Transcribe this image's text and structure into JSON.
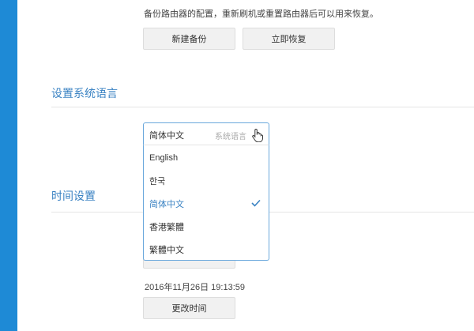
{
  "backup": {
    "description": "备份路由器的配置，重新刷机或重置路由器后可以用来恢复。",
    "new_backup_label": "新建备份",
    "restore_label": "立即恢复"
  },
  "language": {
    "section_title": "设置系统语言",
    "selected_value": "简体中文",
    "selected_hint": "系统语言",
    "options": [
      {
        "label": "English",
        "selected": false
      },
      {
        "label": "한국",
        "selected": false
      },
      {
        "label": "简体中文",
        "selected": true
      },
      {
        "label": "香港繁體",
        "selected": false
      },
      {
        "label": "繁體中文",
        "selected": false
      }
    ]
  },
  "time": {
    "section_title": "时间设置",
    "current_datetime": "2016年11月26日 19:13:59",
    "change_time_label": "更改时间"
  },
  "colors": {
    "sidebar": "#1e8ad6",
    "accent": "#3b83c3",
    "dropdown_border": "#6aa8dc"
  }
}
